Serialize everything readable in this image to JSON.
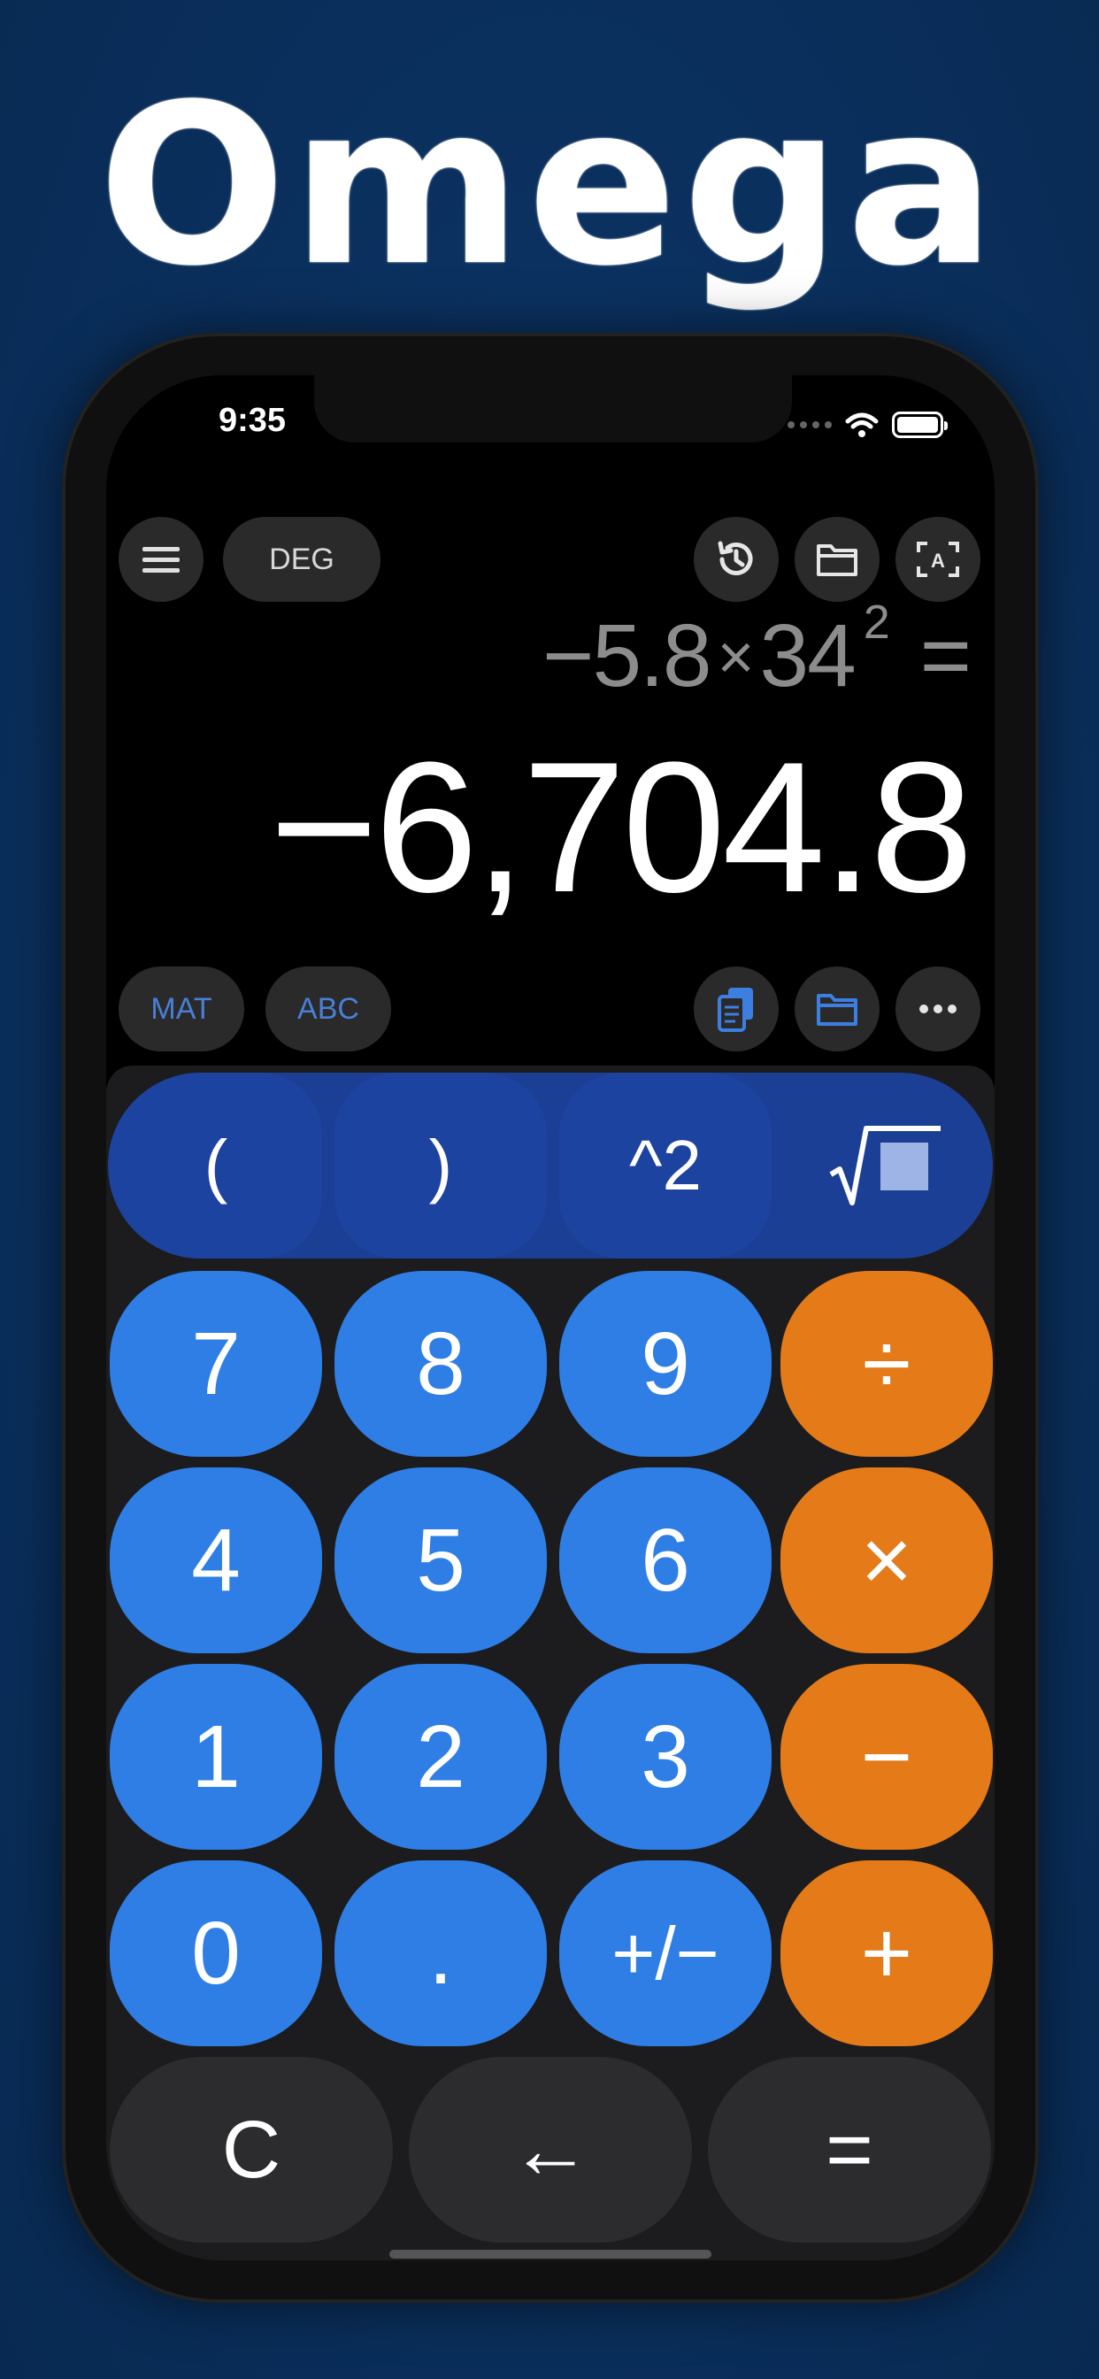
{
  "app_name": "Omega",
  "status_bar": {
    "time": "9:35",
    "icons": [
      "signal-dots-icon",
      "wifi-icon",
      "battery-icon"
    ]
  },
  "toolbar": {
    "menu_icon": "hamburger-menu-icon",
    "angle_mode": "DEG",
    "history_icon": "history-icon",
    "folder_icon": "folder-icon",
    "text_scan_icon": "text-scan-icon"
  },
  "display": {
    "expression": {
      "operand1": "−5.8",
      "operator": "×",
      "operand2": "34",
      "exponent": "2",
      "equals": "="
    },
    "result": "−6,704.8"
  },
  "secondary_toolbar": {
    "mat_label": "MAT",
    "abc_label": "ABC",
    "copy_icon": "copy-icon",
    "folder_icon": "folder-icon",
    "more_icon": "more-dots-icon"
  },
  "keypad": {
    "function_row": [
      "(",
      ")",
      "^2",
      "sqrt-icon"
    ],
    "digits": {
      "row1": [
        "7",
        "8",
        "9"
      ],
      "row2": [
        "4",
        "5",
        "6"
      ],
      "row3": [
        "1",
        "2",
        "3"
      ],
      "row4": [
        "0",
        ".",
        "+/−"
      ]
    },
    "operators": [
      "÷",
      "×",
      "−",
      "+"
    ],
    "bottom_row": [
      "C",
      "←",
      "="
    ]
  },
  "colors": {
    "background": "#0b3160",
    "digit_key": "#2e7ee6",
    "operator_key": "#e47a18",
    "function_row": "#1d43a0",
    "dark_key": "#2c2c2e",
    "accent_text": "#4a7fd8"
  }
}
